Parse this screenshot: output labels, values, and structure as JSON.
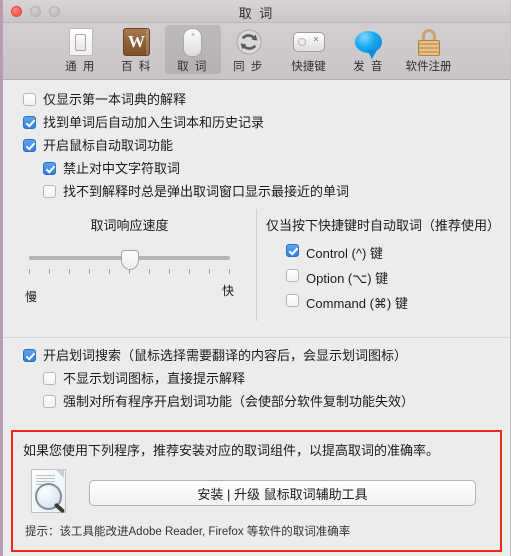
{
  "window": {
    "title": "取 词",
    "traffic": {
      "close": "close-button",
      "minimize": "minimize-button",
      "zoom": "zoom-button"
    }
  },
  "toolbar": {
    "items": [
      {
        "label": "通 用",
        "icon": "switch-icon",
        "selected": false
      },
      {
        "label": "百 科",
        "icon": "wikipedia-book-icon",
        "selected": false
      },
      {
        "label": "取 词",
        "icon": "mouse-icon",
        "selected": true
      },
      {
        "label": "同 步",
        "icon": "sync-refresh-icon",
        "selected": false
      },
      {
        "label": "快捷键",
        "icon": "keyboard-key-icon",
        "selected": false
      },
      {
        "label": "发 音",
        "icon": "speech-bubble-icon",
        "selected": false
      },
      {
        "label": "软件注册",
        "icon": "lock-icon",
        "selected": false
      }
    ]
  },
  "options": {
    "first_dict_only": {
      "label": "仅显示第一本词典的解释",
      "checked": false
    },
    "auto_add_wordbook": {
      "label": "找到单词后自动加入生词本和历史记录",
      "checked": true
    },
    "enable_mouse_capture": {
      "label": "开启鼠标自动取词功能",
      "checked": true
    },
    "disable_chinese": {
      "label": "禁止对中文字符取词",
      "checked": true
    },
    "popup_nearest": {
      "label": "找不到解释时总是弹出取词窗口显示最接近的单词",
      "checked": false
    }
  },
  "speed": {
    "title": "取词响应速度",
    "slow_label": "慢",
    "fast_label": "快",
    "tick_count": 11,
    "value_percent": 50
  },
  "hotkey": {
    "title": "仅当按下快捷键时自动取词（推荐使用）",
    "keys": [
      {
        "label": "Control (^) 键",
        "checked": true
      },
      {
        "label": "Option (⌥) 键",
        "checked": false
      },
      {
        "label": "Command (⌘) 键",
        "checked": false
      }
    ]
  },
  "selection": {
    "enable_selection_search": {
      "label": "开启划词搜索（鼠标选择需要翻译的内容后，会显示划词图标）",
      "checked": true
    },
    "no_icon_direct": {
      "label": "不显示划词图标，直接提示解释",
      "checked": false
    },
    "force_all_apps": {
      "label": "强制对所有程序开启划词功能（会使部分软件复制功能失效）",
      "checked": false
    }
  },
  "recommend": {
    "border_color": "#ee2b12",
    "description": "如果您使用下列程序，推荐安装对应的取词组件，以提高取词的准确率。",
    "icon": "document-magnifier-icon",
    "button_label": "安装 | 升级 鼠标取词辅助工具",
    "hint": "提示：该工具能改进Adobe Reader, Firefox 等软件的取词准确率"
  },
  "colors": {
    "checkbox_on": "#2f7fe0",
    "window_bg": "#ececec",
    "toolbar_bg": "#cfcbcd"
  }
}
